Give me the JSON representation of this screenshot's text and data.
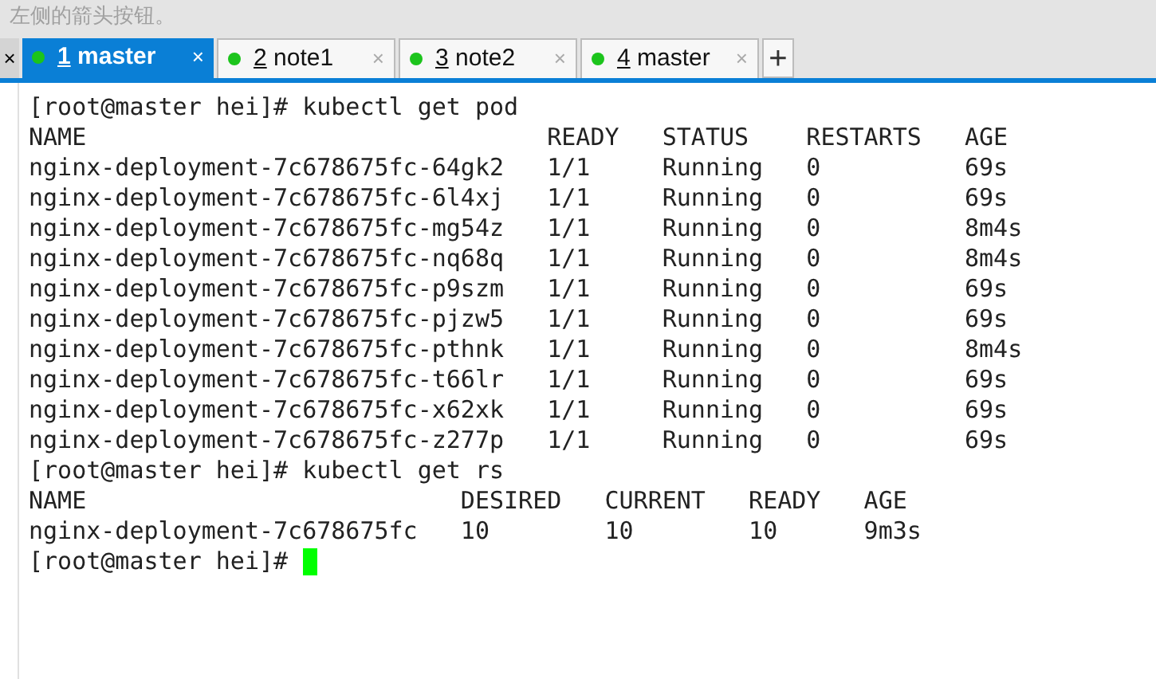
{
  "top_text": "左侧的箭头按钮。",
  "left_close": "×",
  "tabs": [
    {
      "number": "1",
      "label": "master",
      "selected": true,
      "close": "×"
    },
    {
      "number": "2",
      "label": "note1",
      "selected": false,
      "close": "×"
    },
    {
      "number": "3",
      "label": "note2",
      "selected": false,
      "close": "×"
    },
    {
      "number": "4",
      "label": "master",
      "selected": false,
      "close": "×"
    }
  ],
  "new_tab": "+",
  "terminal": {
    "lines": [
      "[root@master hei]# kubectl get pod",
      "NAME                                READY   STATUS    RESTARTS   AGE",
      "nginx-deployment-7c678675fc-64gk2   1/1     Running   0          69s",
      "nginx-deployment-7c678675fc-6l4xj   1/1     Running   0          69s",
      "nginx-deployment-7c678675fc-mg54z   1/1     Running   0          8m4s",
      "nginx-deployment-7c678675fc-nq68q   1/1     Running   0          8m4s",
      "nginx-deployment-7c678675fc-p9szm   1/1     Running   0          69s",
      "nginx-deployment-7c678675fc-pjzw5   1/1     Running   0          69s",
      "nginx-deployment-7c678675fc-pthnk   1/1     Running   0          8m4s",
      "nginx-deployment-7c678675fc-t66lr   1/1     Running   0          69s",
      "nginx-deployment-7c678675fc-x62xk   1/1     Running   0          69s",
      "nginx-deployment-7c678675fc-z277p   1/1     Running   0          69s",
      "[root@master hei]# kubectl get rs",
      "NAME                          DESIRED   CURRENT   READY   AGE",
      "nginx-deployment-7c678675fc   10        10        10      9m3s",
      "[root@master hei]# "
    ]
  }
}
